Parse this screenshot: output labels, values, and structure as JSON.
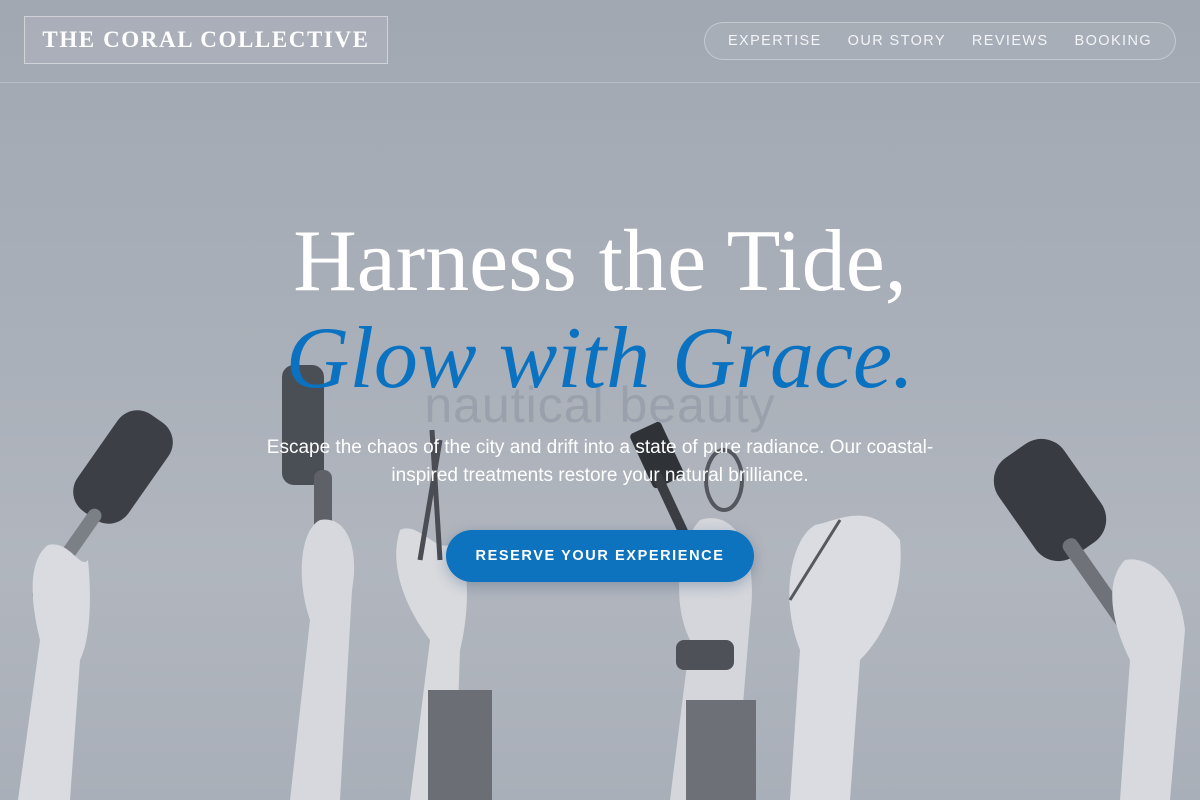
{
  "brand": {
    "name": "THE CORAL COLLECTIVE"
  },
  "nav": {
    "items": [
      {
        "label": "EXPERTISE"
      },
      {
        "label": "OUR STORY"
      },
      {
        "label": "REVIEWS"
      },
      {
        "label": "BOOKING"
      }
    ]
  },
  "hero": {
    "watermark": "nautical beauty",
    "headline_line1": "Harness the Tide,",
    "headline_line2": "Glow with Grace.",
    "lead": "Escape the chaos of the city and drift into a state of pure radiance. Our coastal-inspired treatments restore your natural brilliance.",
    "cta_label": "RESERVE YOUR EXPERIENCE"
  },
  "colors": {
    "accent": "#0a72c0",
    "button": "#0d73bf",
    "overlay": "#a3a9b3"
  }
}
